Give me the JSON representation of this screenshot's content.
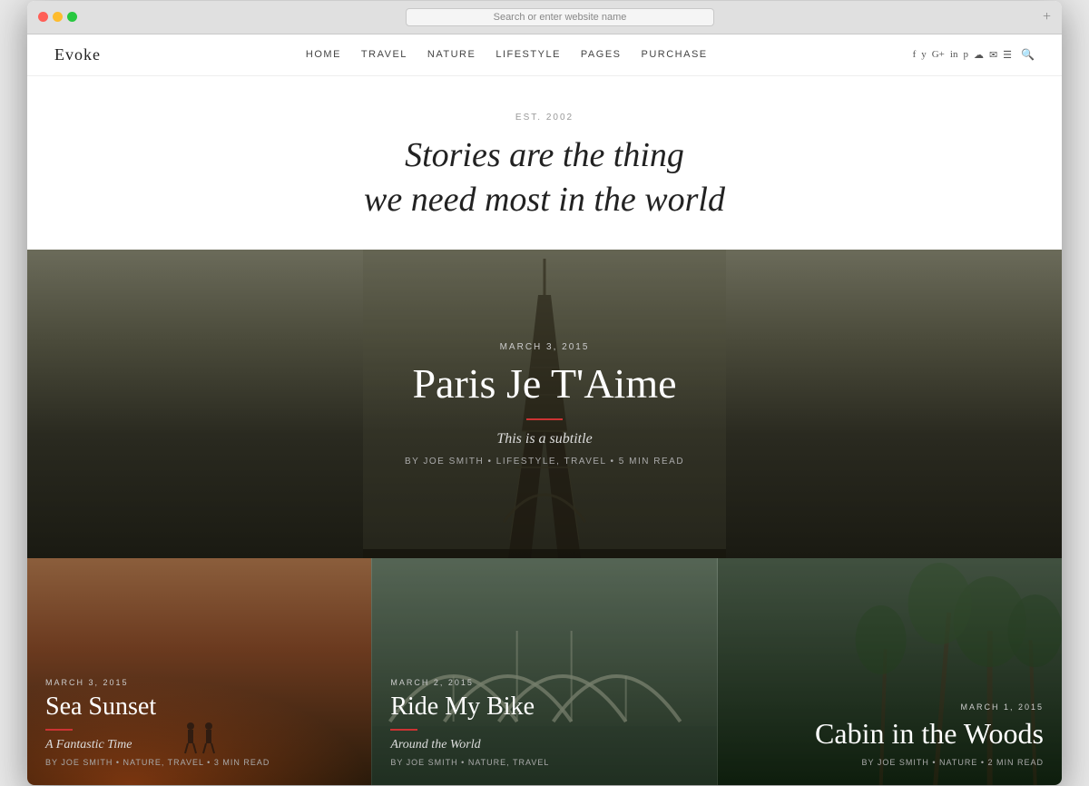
{
  "browser": {
    "address_placeholder": "Search or enter website name",
    "new_tab_label": "+"
  },
  "header": {
    "logo": "Evoke",
    "nav": {
      "items": [
        "HOME",
        "TRAVEL",
        "NATURE",
        "LIFESTYLE",
        "PAGES",
        "PURCHASE"
      ]
    },
    "social_icons": [
      "f",
      "y",
      "G+",
      "in",
      "p",
      "☁",
      "✉",
      "☰"
    ]
  },
  "hero": {
    "est_label": "EST. 2002",
    "quote_line1": "Stories are the thing",
    "quote_line2": "we need most in the world"
  },
  "featured_post": {
    "date": "MARCH 3, 2015",
    "title": "Paris Je T'Aime",
    "subtitle": "This is a subtitle",
    "meta": "BY JOE SMITH  •  LIFESTYLE, TRAVEL  •  5 MIN READ"
  },
  "cards": [
    {
      "date": "MARCH 3, 2015",
      "title": "Sea Sunset",
      "subtitle": "A Fantastic Time",
      "meta": "BY JOE SMITH  •  NATURE, TRAVEL  •  3 MIN READ"
    },
    {
      "date": "MARCH 2, 2015",
      "title": "Ride My Bike",
      "subtitle": "Around the World",
      "meta": "BY JOE SMITH  •  NATURE, TRAVEL"
    },
    {
      "date": "MARCH 1, 2015",
      "title": "Cabin in the Woods",
      "meta": "BY JOE SMITH  •  NATURE  •  2 MIN READ"
    }
  ]
}
